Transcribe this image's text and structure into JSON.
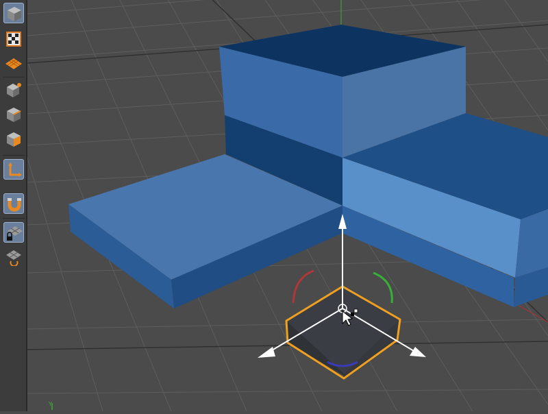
{
  "viewport": {
    "axis_indicator_label": "Y"
  },
  "toolbar": {
    "tools": [
      {
        "name": "model-mode-tool",
        "icon": "cube-icon",
        "active": true
      },
      {
        "name": "texture-mode-tool",
        "icon": "checker-texture-icon",
        "active": false
      },
      {
        "name": "workplane-mode-tool",
        "icon": "plane-grid-icon",
        "active": false
      },
      {
        "name": "points-mode-tool",
        "icon": "points-icon",
        "active": false
      },
      {
        "name": "edges-mode-tool",
        "icon": "edges-icon",
        "active": false
      },
      {
        "name": "polygons-mode-tool",
        "icon": "polygons-icon",
        "active": false
      },
      {
        "name": "axis-mode-tool",
        "icon": "axis-icon",
        "active": true
      },
      {
        "name": "snapping-tool",
        "icon": "magnet-icon",
        "active": true
      },
      {
        "name": "locked-workplane-tool",
        "icon": "lock-grid-icon",
        "active": true
      },
      {
        "name": "planar-workplane-tool",
        "icon": "rotate-grid-icon",
        "active": false
      }
    ]
  },
  "colors": {
    "viewport_bg": "#4a4a4a",
    "grid_line": "#5a5a5a",
    "grid_major": "#3a3a3a",
    "model_top": "#4776ad",
    "model_front": "#2e5f98",
    "model_dark": "#103c6c",
    "model_light": "#5c93cc",
    "selection_outline": "#f0a020",
    "axis_y": "#3cb43c",
    "axis_x": "#c83232"
  }
}
